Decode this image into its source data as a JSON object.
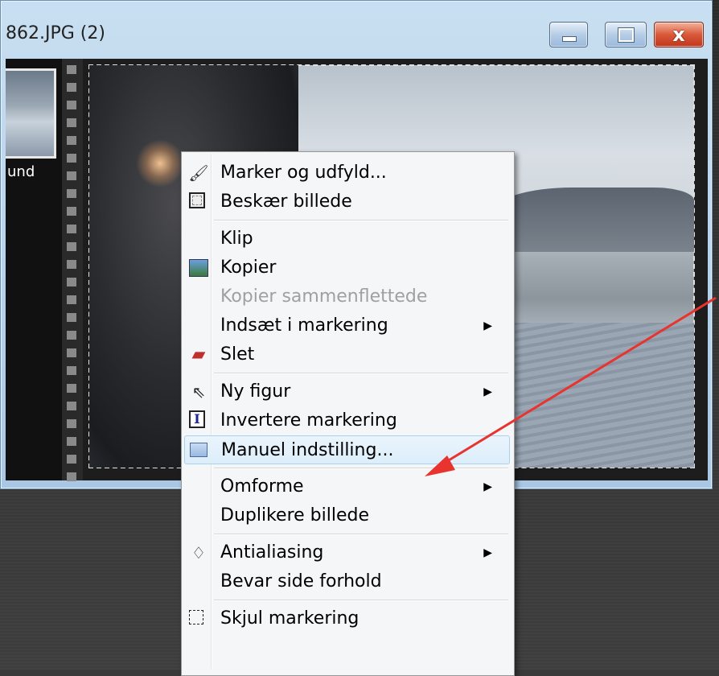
{
  "window": {
    "title": "862.JPG (2)",
    "controls": {
      "minimize": "minimize",
      "maximize": "maximize",
      "close": "x"
    }
  },
  "thumbnail": {
    "label": "und"
  },
  "context_menu": {
    "items": [
      {
        "label": "Marker og udfyld...",
        "icon": "marker-fill-icon",
        "submenu": false,
        "disabled": false
      },
      {
        "label": "Beskær billede",
        "icon": "crop-icon",
        "submenu": false,
        "disabled": false
      },
      {
        "separator": true
      },
      {
        "label": "Klip",
        "icon": null,
        "submenu": false,
        "disabled": false
      },
      {
        "label": "Kopier",
        "icon": "copy-image-icon",
        "submenu": false,
        "disabled": false
      },
      {
        "label": "Kopier sammenflettede",
        "icon": null,
        "submenu": false,
        "disabled": true
      },
      {
        "label": "Indsæt i markering",
        "icon": null,
        "submenu": true,
        "disabled": false
      },
      {
        "label": "Slet",
        "icon": "eraser-icon",
        "submenu": false,
        "disabled": false
      },
      {
        "separator": true
      },
      {
        "label": "Ny figur",
        "icon": "cursor-icon",
        "submenu": true,
        "disabled": false
      },
      {
        "label": "Invertere markering",
        "icon": "invert-selection-icon",
        "submenu": false,
        "disabled": false
      },
      {
        "label": "Manuel indstilling...",
        "icon": "manual-settings-icon",
        "submenu": false,
        "disabled": false,
        "highlighted": true
      },
      {
        "separator": true
      },
      {
        "label": "Omforme",
        "icon": null,
        "submenu": true,
        "disabled": false
      },
      {
        "label": "Duplikere billede",
        "icon": null,
        "submenu": false,
        "disabled": false
      },
      {
        "separator": true
      },
      {
        "label": "Antialiasing",
        "icon": "antialiasing-drop-icon",
        "submenu": true,
        "disabled": false
      },
      {
        "label": "Bevar side forhold",
        "icon": null,
        "submenu": false,
        "disabled": false
      },
      {
        "separator": true
      },
      {
        "label": "Skjul markering",
        "icon": "hide-selection-icon",
        "submenu": false,
        "disabled": false
      }
    ]
  },
  "colors": {
    "annotation_arrow": "#e8332e",
    "menu_highlight_border": "#a9d2f1"
  }
}
